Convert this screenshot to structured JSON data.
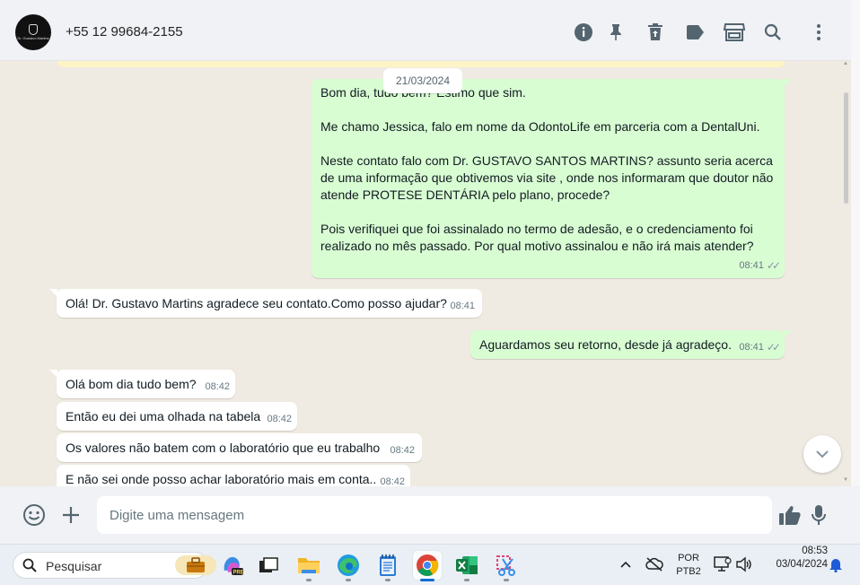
{
  "header": {
    "contact_name": "+55 12 99684-2155",
    "avatar_logo_text": "Dr. Gustavo Martins",
    "icons": [
      "info-icon",
      "pin-icon",
      "trash-icon",
      "label-icon",
      "catalog-icon",
      "search-icon",
      "menu-dots-icon"
    ]
  },
  "chat": {
    "date_label": "21/03/2024",
    "messages": [
      {
        "direction": "outgoing",
        "text": "Bom dia, tudo bem? Estimo que sim.\n\nMe chamo Jessica, falo em nome da OdontoLife em parceria com a DentalUni.\n\nNeste contato falo com Dr. GUSTAVO SANTOS MARTINS? assunto seria acerca de uma informação que obtivemos via site , onde nos informaram que doutor não atende PROTESE DENTÁRIA pelo plano, procede?\n\nPois verifiquei que foi assinalado no termo de adesão, e o credenciamento foi realizado no mês passado. Por qual motivo assinalou e não irá mais atender?",
        "time": "08:41",
        "status": "read"
      },
      {
        "direction": "incoming",
        "text": "Olá! Dr. Gustavo Martins agradece seu contato.Como posso ajudar?",
        "time": "08:41"
      },
      {
        "direction": "outgoing",
        "text": "Aguardamos seu retorno, desde já agradeço.",
        "time": "08:41",
        "status": "read"
      },
      {
        "direction": "incoming",
        "text": "Olá bom dia tudo bem?",
        "time": "08:42"
      },
      {
        "direction": "incoming",
        "text": "Então eu dei uma olhada na tabela",
        "time": "08:42"
      },
      {
        "direction": "incoming",
        "text": "Os valores não batem com o laboratório que eu trabalho",
        "time": "08:42"
      },
      {
        "direction": "incoming",
        "text": "E não sei onde posso achar laboratório mais em conta..",
        "time": "08:42"
      }
    ]
  },
  "composer": {
    "placeholder": "Digite uma mensagem",
    "icons": [
      "emoji-icon",
      "plus-icon",
      "thumbs-up-icon",
      "microphone-icon"
    ]
  },
  "taskbar": {
    "search_label": "Pesquisar",
    "apps": [
      "copilot-icon",
      "task-view-icon",
      "file-explorer-icon",
      "edge-icon",
      "notepad-icon",
      "chrome-icon",
      "excel-icon",
      "snipping-tool-icon"
    ],
    "active_app": "chrome-icon",
    "language_line1": "POR",
    "language_line2": "PTB2",
    "clock_time": "08:53",
    "clock_date": "03/04/2024"
  },
  "colors": {
    "outgoing_bubble": "#d9fdd3",
    "incoming_bubble": "#ffffff",
    "chat_background": "#efeae2",
    "header_icon": "#54656f"
  }
}
